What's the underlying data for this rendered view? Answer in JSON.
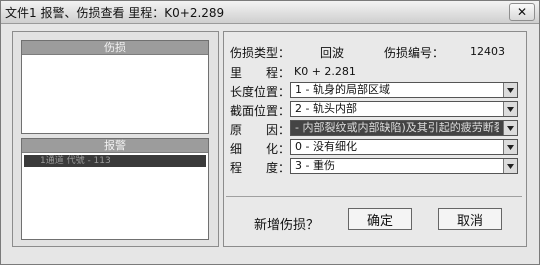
{
  "window": {
    "title": "文件1 报警、伤损查看 里程：K0+2.289",
    "close_glyph": "✕"
  },
  "left": {
    "damage_header": "伤损",
    "report_header": "报警",
    "report_rows": [
      "1通道 代號 - 113"
    ]
  },
  "form": {
    "damage_type_label": "伤损类型：",
    "damage_type_value": "回波",
    "damage_no_label": "伤损编号：",
    "damage_no_value": "12403",
    "mileage_label": "里　　程：",
    "mileage_value": "K0 + 2.281",
    "length_pos_label": "长度位置：",
    "length_pos_value": "1 - 轨身的局部区域",
    "section_pos_label": "截面位置：",
    "section_pos_value": "2 - 轨头内部",
    "cause_label": "原　　因：",
    "cause_value": "- 内部裂纹或内部缺陷)及其引起的疲劳断裂",
    "detail_label": "细　　化：",
    "detail_value": "0 - 没有细化",
    "degree_label": "程　　度：",
    "degree_value": "3 - 重伤"
  },
  "footer": {
    "new_damage_label": "新增伤损？",
    "ok_label": "确定",
    "cancel_label": "取消"
  },
  "icons": {
    "dropdown": "chevron-down-icon",
    "close": "close-icon"
  }
}
